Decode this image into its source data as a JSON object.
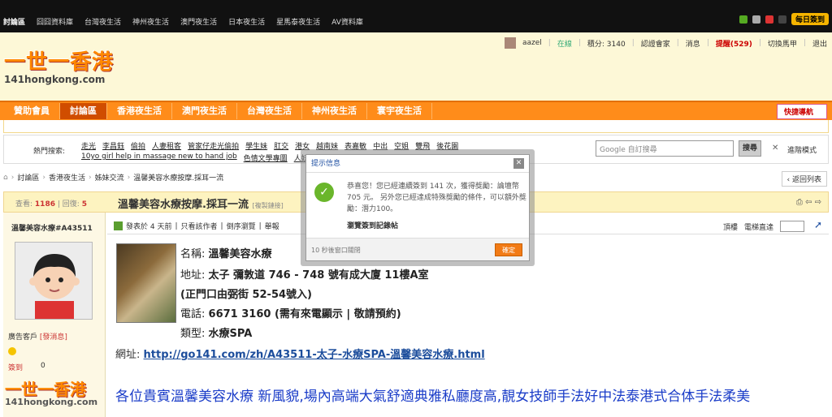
{
  "top_nav": [
    "討論區",
    "囧囧資料庫",
    "台灣夜生活",
    "神州夜生活",
    "澳門夜生活",
    "日本夜生活",
    "星馬泰夜生活",
    "AV資料庫"
  ],
  "checkin_button": "每日簽到",
  "user_bar": {
    "username": "aazel",
    "status": "在線",
    "points": "積分: 3140",
    "verify": "認證會家",
    "messages": "消息",
    "reminders": "提醒(529)",
    "switch": "切換馬甲",
    "logout": "退出"
  },
  "logo": {
    "big": "一世一香港",
    "small": "141hongkong.com"
  },
  "main_nav": [
    "贊助會員",
    "討論區",
    "香港夜生活",
    "澳門夜生活",
    "台灣夜生活",
    "神州夜生活",
    "寰宇夜生活"
  ],
  "quick_nav": "快捷導航",
  "hot_search": {
    "label": "熱門搜索:",
    "links": [
      "走光",
      "李昌鈺",
      "偷拍",
      "人妻租客",
      "管家仔走光偷拍",
      "學生妹",
      "肛交",
      "港女",
      "越南妹",
      "表嘉敏",
      "中出",
      "空姐",
      "雙飛",
      "後花園",
      "10yo girl help in massage new to hand job",
      "色情文學專圖",
      "人妖"
    ]
  },
  "search": {
    "placeholder": "Google  自訂搜尋",
    "button": "搜尋",
    "advanced": "進階模式"
  },
  "breadcrumbs": [
    "討論區",
    "香港夜生活",
    "姊妹交流",
    "溫馨美容水療按摩.採耳一流"
  ],
  "back_button": "返回列表",
  "thread": {
    "views_label": "查看:",
    "views": "1186",
    "replies_label": "回復:",
    "replies": "5",
    "title": "溫馨美容水療按摩.採耳一流",
    "copy_link": "[複製鏈接]"
  },
  "author": {
    "name": "溫馨美容水療#A43511",
    "group": "廣告客戶",
    "send_message": "[發消息]",
    "checkin_label": "簽到",
    "checkin_value": "0"
  },
  "post_meta": {
    "posted": "發表於 4 天前",
    "only_author": "只看該作者",
    "reverse": "倒序瀏覽",
    "report": "舉報",
    "top": "頂樓",
    "goto": "電梯直達"
  },
  "post": {
    "name_label": "名稱:",
    "name_value": "溫馨美容水療",
    "address_label": "地址:",
    "address_value": "太子 彌敦道 746 - 748 號有成大廈 11樓A室",
    "entrance": "(正門口由弼街 52-54號入)",
    "phone_label": "電話:",
    "phone_value": "6671 3160 (需有來電顯示 | 敬請預約)",
    "type_label": "類型:",
    "type_value": "水療SPA",
    "url_label": "網址:",
    "url_value": "http://go141.com/zh/A43511-太子-水療SPA-溫馨美容水療.html",
    "headline": "各位貴賓溫馨美容水療 新風貌,場內高端大氣舒適典雅私廳度高,靚女技師手法好中法泰港式合体手法柔美"
  },
  "popup": {
    "title": "提示信息",
    "message": "恭喜您！您已經連續簽到 141 次，獲得獎勵：論壇幣 705 元。 另外您已經達成特殊獎勵的條件，可以額外獎勵：潛力100。",
    "link": "瀏覽簽到記錄帖",
    "countdown": "10 秒後窗口關閉",
    "ok": "確定"
  }
}
